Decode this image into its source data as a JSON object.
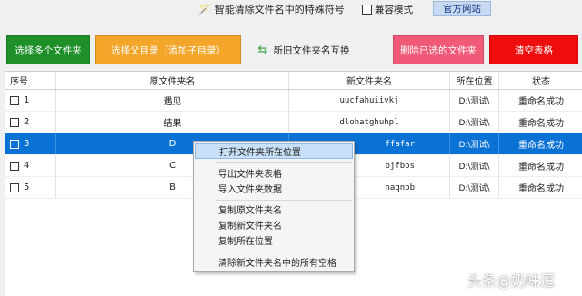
{
  "window": {
    "title": "智能清除文件名中的特殊符号",
    "compat_label": "兼容模式",
    "site_label": "官方网站"
  },
  "toolbar": {
    "select_folders": "选择多个文件夹",
    "select_parent": "选择父目录（添加子目录）",
    "swap": "新旧文件夹名互换",
    "delete_selected": "删除已选的文件夹",
    "clear_table": "清空表格"
  },
  "table": {
    "headers": [
      "序号",
      "原文件夹名",
      "新文件夹名",
      "所在位置",
      "状态"
    ],
    "rows": [
      {
        "index": "1",
        "original": "遇见",
        "new": "uucfahuiivkj",
        "location": "D:\\测试\\",
        "status": "重命名成功"
      },
      {
        "index": "2",
        "original": "结果",
        "new": "dlohatghuhpl",
        "location": "D:\\测试\\",
        "status": "重命名成功"
      },
      {
        "index": "3",
        "original": "D",
        "new": "ffafar",
        "location": "D:\\测试\\",
        "status": "重命名成功"
      },
      {
        "index": "4",
        "original": "C",
        "new": "bjfbos",
        "location": "D:\\测试\\",
        "status": "重命名成功"
      },
      {
        "index": "5",
        "original": "B",
        "new": "naqnpb",
        "location": "D:\\测试\\",
        "status": "重命名成功"
      }
    ]
  },
  "context_menu": {
    "open_location": "打开文件夹所在位置",
    "export_table": "导出文件夹表格",
    "import_data": "导入文件夹数据",
    "copy_original": "复制原文件夹名",
    "copy_new": "复制新文件夹名",
    "copy_location": "复制所在位置",
    "clear_spaces": "清除新文件夹名中的所有空格"
  },
  "watermark": "头条@奶味逗",
  "colors": {
    "select_folders": "#1f8f2a",
    "select_parent": "#f4a62b",
    "delete_selected": "#f05a78",
    "clear_table": "#ee0c0c",
    "selection": "#0a72d4"
  },
  "icons": {
    "title": "magic-wand-icon",
    "swap": "swap-arrows-icon"
  }
}
